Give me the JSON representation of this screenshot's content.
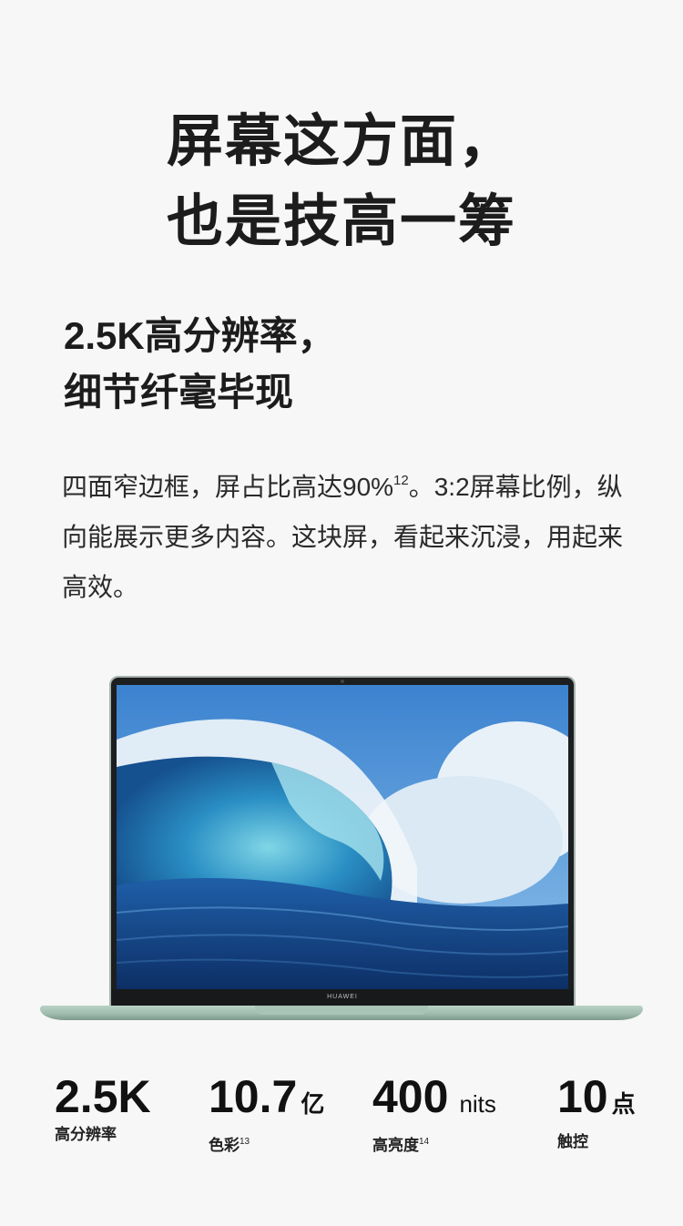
{
  "headline": {
    "line1": "屏幕这方面，",
    "line2": "也是技高一筹"
  },
  "subhead": {
    "line1": "2.5K高分辨率，",
    "line2": "细节纤毫毕现"
  },
  "body": {
    "part1": "四面窄边框，屏占比高达90%",
    "footnote1": "12",
    "part2": "。3:2屏幕比例，纵向能展示更多内容。这块屏，看起来沉浸，用起来高效。"
  },
  "laptop": {
    "brand": "HUAWEI",
    "screen_image": "ocean-wave-image",
    "body_color": "#a8c4b6"
  },
  "stats": [
    {
      "value": "2.5K",
      "unit": "",
      "label": "高分辨率",
      "footnote": ""
    },
    {
      "value": "10.7",
      "unit": "亿",
      "label": "色彩",
      "footnote": "13"
    },
    {
      "value": "400",
      "unit": "nits",
      "label": "高亮度",
      "footnote": "14"
    },
    {
      "value": "10",
      "unit": "点",
      "label": "触控",
      "footnote": ""
    }
  ]
}
